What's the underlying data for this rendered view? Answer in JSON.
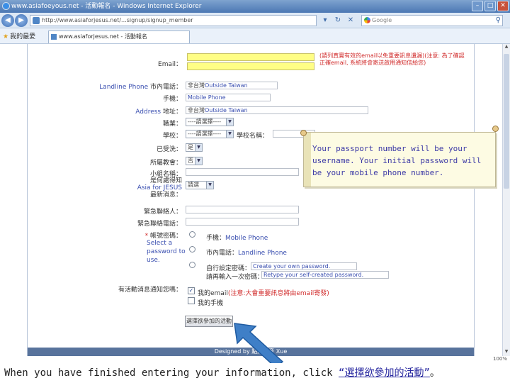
{
  "window": {
    "title": "www.asiafoeyous.net - 活動報名 - Windows Internet Explorer",
    "buttons": [
      "–",
      "□",
      "✕"
    ]
  },
  "addressbar": {
    "back_icon": "back-arrow-icon",
    "forward_icon": "forward-arrow-icon",
    "url": "http://www.asiaforjesus.net/...signup/signup_member",
    "search_placeholder": "Google"
  },
  "favorites": {
    "label": "我的最愛"
  },
  "tab": {
    "label": "www.asiaforjesus.net - 活動報名"
  },
  "form": {
    "email_label": "Email：",
    "email_note": "(請列真實有效的email以免重要訊息遺漏)(注意: 為了確認正確email, 系統將會寄送啟用通知信給您)",
    "landline_label_en": "Landline Phone",
    "landline_label_zh": "市內電話：",
    "landline_value_prefix": "非台灣",
    "landline_value": "Outside Taiwan",
    "mobile_label_zh": "手機：",
    "mobile_value": "Mobile Phone",
    "address_label_en": "Address",
    "address_label_zh": "地址：",
    "address_value_prefix": "非台灣",
    "address_value": "Outside Taiwan",
    "dept_label": "職業：",
    "dept_select": "----請選擇----",
    "school_label": "學校：",
    "school_select": "----請選擇----",
    "school_name_label": "學校名稱：",
    "baptized_label": "已受洗：",
    "baptized_value": "是",
    "church_label": "所屬教會：",
    "church_value": "否",
    "fellowship_label": "小組名稱：",
    "heard_label": "是何處得知",
    "heard_label_en": "Asia for JESUS",
    "heard_label2": "最新消息：",
    "heard_select": "請選",
    "emergency_label": "緊急聯絡人：",
    "emergency_phone_label": "緊急聯絡電話：",
    "password_label": "帳號密碼：",
    "password_star": "*",
    "password_hint": "Select a password to use.",
    "pwd_option1_zh": "手機：",
    "pwd_option1_en": "Mobile Phone",
    "pwd_option2_zh": "市內電話：",
    "pwd_option2_en": "Landline Phone",
    "pwd_option3_label": "自行設定密碼：",
    "pwd_option3_value": "Create your own password.",
    "pwd_confirm_label": "請再輸入一次密碼：",
    "pwd_confirm_value": "Retype your self-created password.",
    "notify_label": "有活動消息通知您嗎：",
    "notify_email": "我的email",
    "notify_email_note": "(注意:大會重要訊息將由email寄發)",
    "notify_mobile": "我的手機",
    "submit_label": "選擇欲參加的活動",
    "footer": "Designed by 點點創意 Xue"
  },
  "callout": {
    "text": "Your passport number will be your username. Your initial password will be your mobile phone number."
  },
  "caption": {
    "text": "When you have finished entering your information, click ",
    "highlight": "“選擇欲參加的活動”",
    "end": "。"
  },
  "status": {
    "zoom": "100%"
  },
  "colors": {
    "email_field": "#fffe85",
    "annotation_blue": "#3a4fb0",
    "warning_red": "#d12c2c",
    "arrow": "#3f7fc7",
    "footer_bar": "#58739c"
  }
}
